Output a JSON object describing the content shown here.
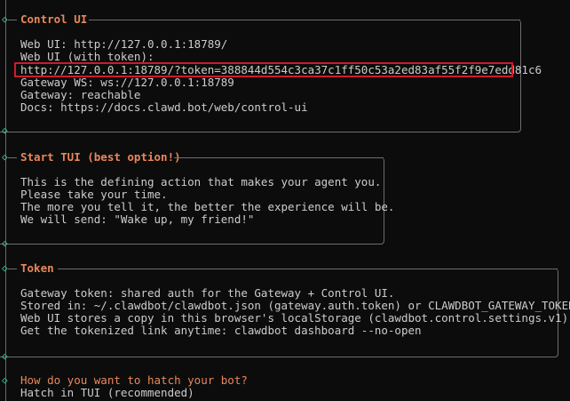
{
  "sections": [
    {
      "title": "Control UI",
      "lines": [
        "Web UI: http://127.0.0.1:18789/",
        "Web UI (with token):",
        "http://127.0.0.1:18789/?token=388844d554c3ca37c1ff50c53a2ed83af55f2f9e7edd81c6",
        "Gateway WS: ws://127.0.0.1:18789",
        "Gateway: reachable",
        "Docs: https://docs.clawd.bot/web/control-ui"
      ]
    },
    {
      "title": "Start TUI (best option!)",
      "lines": [
        "This is the defining action that makes your agent you.",
        "Please take your time.",
        "The more you tell it, the better the experience will be.",
        "We will send: \"Wake up, my friend!\""
      ]
    },
    {
      "title": "Token",
      "lines": [
        "Gateway token: shared auth for the Gateway + Control UI.",
        "Stored in: ~/.clawdbot/clawdbot.json (gateway.auth.token) or CLAWDBOT_GATEWAY_TOKEN.",
        "Web UI stores a copy in this browser's localStorage (clawdbot.control.settings.v1).",
        "Get the tokenized link anytime: clawdbot dashboard --no-open"
      ]
    }
  ],
  "prompt": {
    "question": "How do you want to hatch your bot?",
    "selected": "Hatch in TUI (recommended)"
  },
  "icons": {
    "bullet": "diamond-icon"
  },
  "colors": {
    "accent": "#e9875b",
    "bullet": "#4ec9a0",
    "highlight": "#d11a2a",
    "text": "#cccccc",
    "background": "#0c0c0c"
  }
}
